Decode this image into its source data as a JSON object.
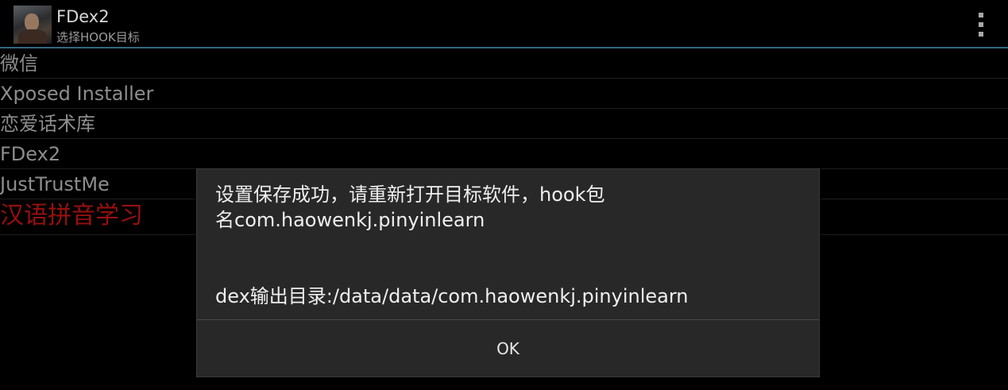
{
  "action_bar": {
    "title": "FDex2",
    "subtitle": "选择HOOK目标",
    "icon": "app-avatar-icon",
    "overflow_icon": "overflow-menu-icon"
  },
  "app_list": {
    "items": [
      {
        "label": "微信"
      },
      {
        "label": "Xposed Installer"
      },
      {
        "label": "恋爱话术库"
      },
      {
        "label": "FDex2"
      },
      {
        "label": "JustTrustMe"
      },
      {
        "label": "汉语拼音学习",
        "selected": true
      }
    ]
  },
  "dialog": {
    "message_line1": "设置保存成功，请重新打开目标软件，hook包",
    "message_line2": "名com.haowenkj.pinyinlearn",
    "dex_dir": "dex输出目录:/data/data/com.haowenkj.pinyinlearn",
    "ok_label": "OK"
  },
  "colors": {
    "background": "#000000",
    "accent_line": "#33667f",
    "list_text": "#8d8d8d",
    "selected_text": "#990f0f",
    "dialog_bg": "#282828"
  }
}
